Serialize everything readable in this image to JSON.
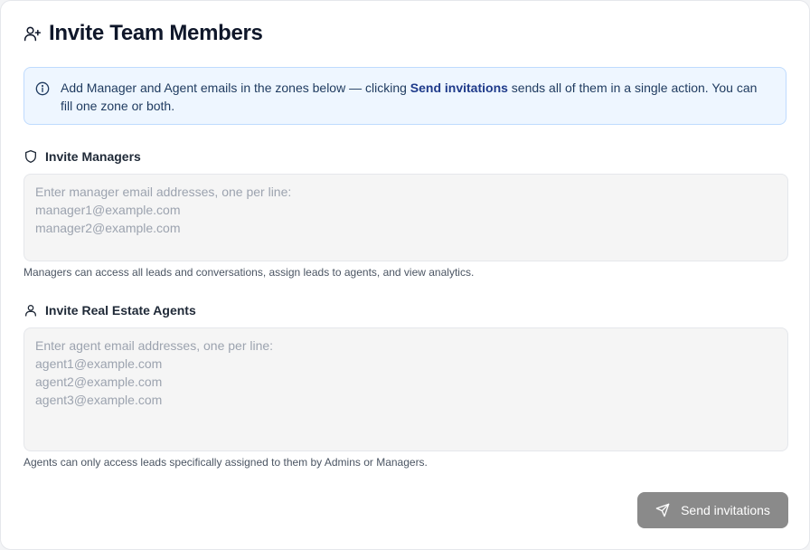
{
  "header": {
    "title": "Invite Team Members",
    "icon": "user-plus-icon"
  },
  "info": {
    "icon": "info-circle-icon",
    "text_before": "Add Manager and Agent emails in the zones below — clicking ",
    "text_bold": "Send invitations",
    "text_after": " sends all of them in a single action. You can fill one zone or both."
  },
  "managers": {
    "label": "Invite Managers",
    "icon": "shield-icon",
    "value": "",
    "placeholder": "Enter manager email addresses, one per line:\nmanager1@example.com\nmanager2@example.com",
    "hint": "Managers can access all leads and conversations, assign leads to agents, and view analytics."
  },
  "agents": {
    "label": "Invite Real Estate Agents",
    "icon": "user-icon",
    "value": "",
    "placeholder": "Enter agent email addresses, one per line:\nagent1@example.com\nagent2@example.com\nagent3@example.com",
    "hint": "Agents can only access leads specifically assigned to them by Admins or Managers."
  },
  "send_button": {
    "label": "Send invitations",
    "icon": "send-icon"
  },
  "colors": {
    "info_bg": "#eef6ff",
    "info_border": "#bfdbfe",
    "button_disabled": "#8a8a8a"
  }
}
